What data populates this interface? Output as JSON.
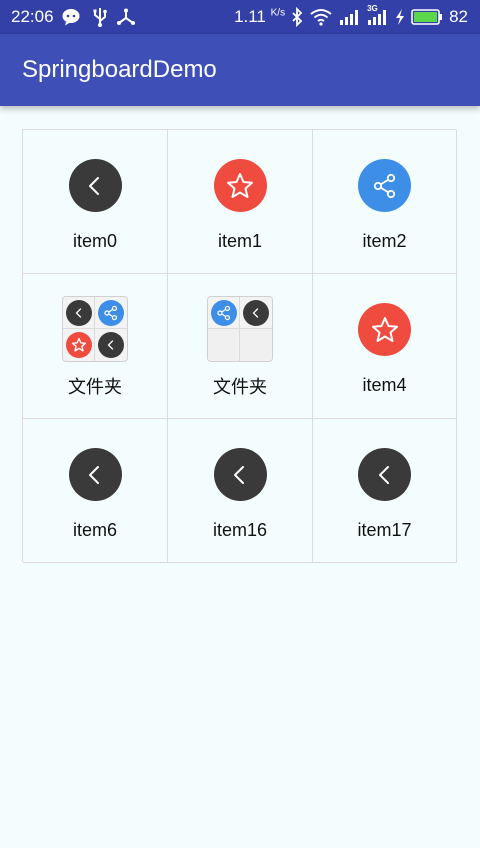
{
  "status_bar": {
    "time": "22:06",
    "net_speed_value": "1.11",
    "net_speed_unit": "K/s",
    "signal_label": "3G",
    "battery_level": "82",
    "icons": [
      "wechat-icon",
      "usb-icon",
      "usb-debug-icon",
      "bluetooth-icon",
      "wifi-icon",
      "signal-icon",
      "signal-3g-icon",
      "charging-icon",
      "battery-icon"
    ]
  },
  "app_bar": {
    "title": "SpringboardDemo"
  },
  "colors": {
    "status_bar": "#3240a8",
    "app_bar": "#3f4fb8",
    "background": "#f4fdfd",
    "dark_icon": "#3a3a3a",
    "red_icon": "#ef4b3f",
    "blue_icon": "#3d8ee6",
    "battery_fill": "#5cd64a"
  },
  "grid": {
    "items": [
      {
        "label": "item0",
        "icon": "back-icon"
      },
      {
        "label": "item1",
        "icon": "star-icon"
      },
      {
        "label": "item2",
        "icon": "share-icon"
      },
      {
        "label": "文件夹",
        "type": "folder",
        "icons": [
          "back-icon",
          "share-icon",
          "star-icon",
          "back-icon"
        ]
      },
      {
        "label": "文件夹",
        "type": "folder",
        "icons": [
          "share-icon",
          "back-icon"
        ]
      },
      {
        "label": "item4",
        "icon": "star-icon"
      },
      {
        "label": "item6",
        "icon": "back-icon"
      },
      {
        "label": "item16",
        "icon": "back-icon"
      },
      {
        "label": "item17",
        "icon": "back-icon"
      }
    ]
  }
}
